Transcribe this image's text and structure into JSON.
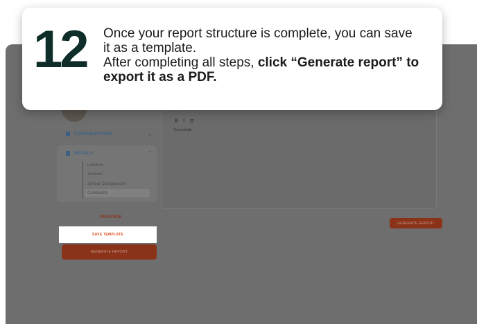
{
  "callout": {
    "step_number": "12",
    "line1": "Once your report structure is complete, you can save it as a template.",
    "line2_prefix": "After completing all steps, ",
    "line2_bold": "click “Generate report” to export it as a PDF."
  },
  "sidebar": {
    "configuration_label": "CONFIGURATION",
    "details_label": "DETAILS",
    "sub_items": [
      "Location",
      "Sensors",
      "Sensor Comparisons",
      "Conclusion"
    ],
    "preview_label": "PREVIEW",
    "save_template_label": "SAVE TEMPLATE",
    "generate_report_label": "GENERATE REPORT"
  },
  "editor": {
    "toolbar": [
      "B",
      "I",
      "☰"
    ],
    "content": "To conclude"
  },
  "main": {
    "generate_report_label": "GENERATE REPORT"
  },
  "colors": {
    "accent": "#e0491c",
    "step_number": "#0f2e2a",
    "overlay": "#6e6e6e"
  }
}
